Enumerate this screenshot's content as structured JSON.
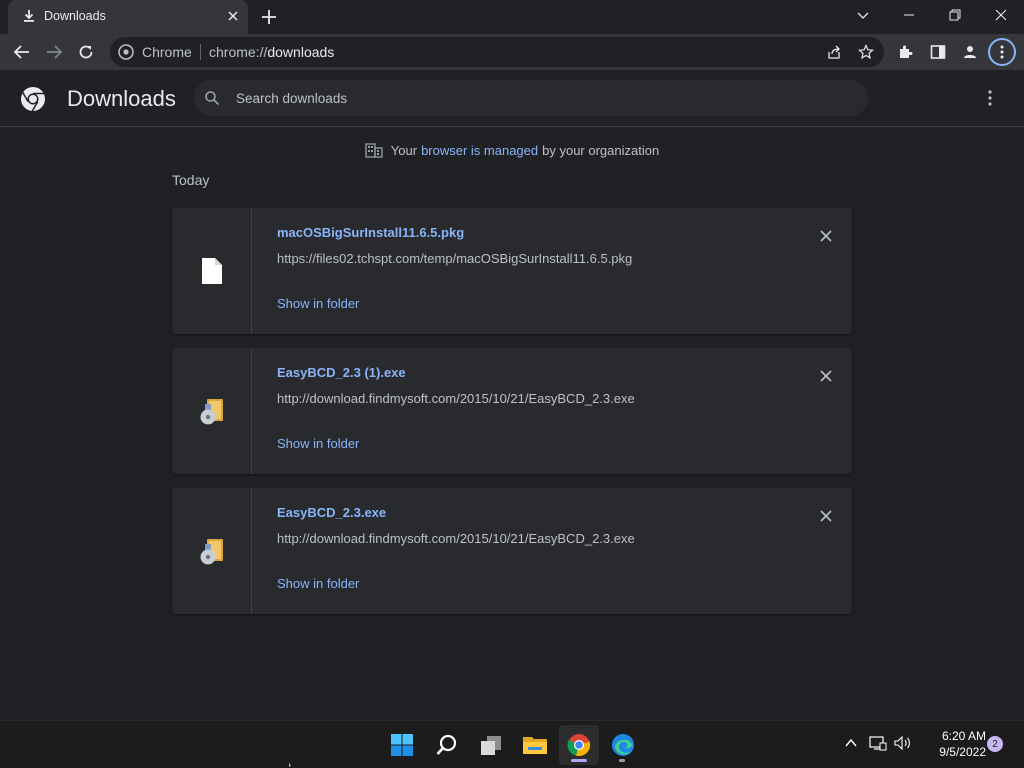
{
  "browser": {
    "tab": {
      "title": "Downloads",
      "icon": "download-icon"
    },
    "omnibox": {
      "chip": "Chrome",
      "url_scheme": "chrome://",
      "url_host": "downloads"
    }
  },
  "downloads_page": {
    "title": "Downloads",
    "search": {
      "placeholder": "Search downloads",
      "value": ""
    },
    "managed_notice": {
      "prefix": "Your",
      "link": "browser is managed",
      "suffix": "by your organization"
    },
    "section_label": "Today",
    "items": [
      {
        "filename": "macOSBigSurInstall11.6.5.pkg",
        "url": "https://files02.tchspt.com/temp/macOSBigSurInstall11.6.5.pkg",
        "action": "Show in folder",
        "icon": "file-icon"
      },
      {
        "filename": "EasyBCD_2.3 (1).exe",
        "url": "http://download.findmysoft.com/2015/10/21/EasyBCD_2.3.exe",
        "action": "Show in folder",
        "icon": "installer-icon"
      },
      {
        "filename": "EasyBCD_2.3.exe",
        "url": "http://download.findmysoft.com/2015/10/21/EasyBCD_2.3.exe",
        "action": "Show in folder",
        "icon": "installer-icon"
      }
    ]
  },
  "taskbar": {
    "apps": [
      "start-icon",
      "search-icon",
      "task-view-icon",
      "file-explorer-icon",
      "chrome-icon",
      "edge-icon"
    ],
    "clock": {
      "time": "6:20 AM",
      "date": "9/5/2022"
    },
    "notification_count": "2"
  }
}
